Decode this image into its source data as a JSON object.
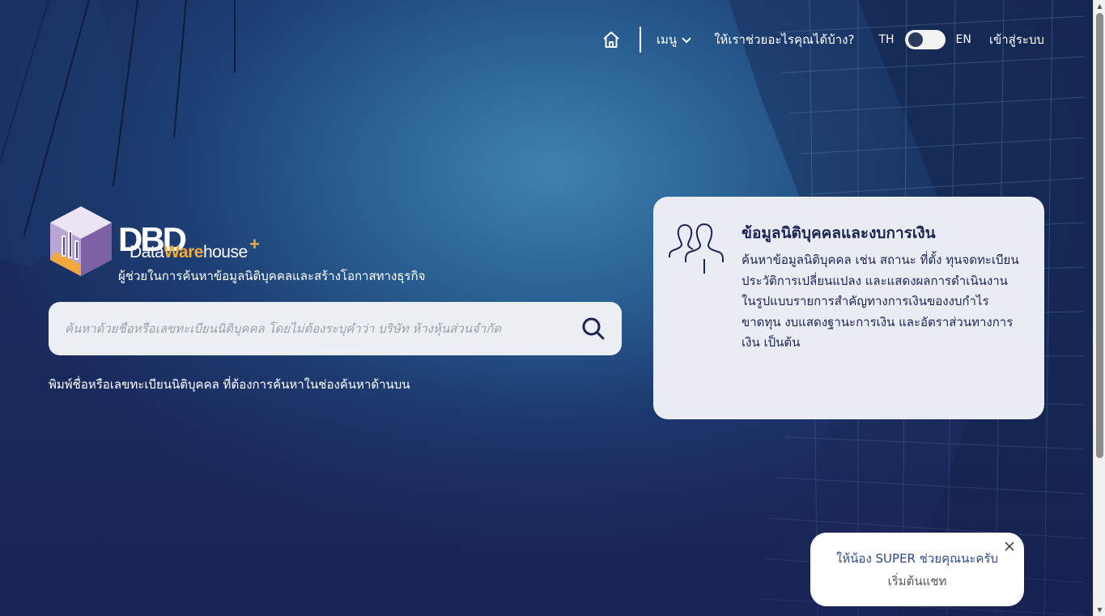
{
  "nav": {
    "menu_label": "เมนู",
    "help_label": "ให้เราช่วยอะไรคุณได้บ้าง?",
    "lang_th": "TH",
    "lang_en": "EN",
    "login_label": "เข้าสู่ระบบ"
  },
  "logo": {
    "dbd": "DBD",
    "data": "Data",
    "ware": "Ware",
    "house": "house",
    "plus": "+",
    "tagline": "ผู้ช่วยในการค้นหาข้อมูลนิติบุคคลและสร้างโอกาสทางธุรกิจ"
  },
  "search": {
    "placeholder": "ค้นหาด้วยชื่อหรือเลขทะเบียนนิติบุคคล โดยไม่ต้องระบุคำว่า บริษัท ห้างหุ้นส่วนจำกัด",
    "value": ""
  },
  "hint": "พิมพ์ชื่อหรือเลขทะเบียนนิติบุคคล ที่ต้องการค้นหาในช่องค้นหาด้านบน",
  "info_card": {
    "title": "ข้อมูลนิติบุคคลและงบการเงิน",
    "line1": "ค้นหาข้อมูลนิติบุคคล เช่น สถานะ ที่ตั้ง ทุนจดทะเบียน ประวัติการเปลี่ยนแปลง และแสดงผลการดำเนินงาน",
    "line2": "ในรูปแบบรายการสำคัญทางการเงินของงบกำไรขาดทุน งบแสดงฐานะการเงิน และอัตราส่วนทางการเงิน เป็นต้น"
  },
  "chat": {
    "title": "ให้น้อง SUPER ช่วยคุณนะครับ",
    "subtitle": "เริ่มต้นแชท"
  },
  "icons": {
    "home": "home-icon",
    "chevron": "chevron-down-icon",
    "search": "search-icon",
    "people": "people-icon",
    "close": "close-icon"
  },
  "colors": {
    "navy_text": "#1c2456",
    "accent_orange": "#f2a93b",
    "card_bg": "#e9edf3",
    "chat_text": "#2f4a8c"
  }
}
